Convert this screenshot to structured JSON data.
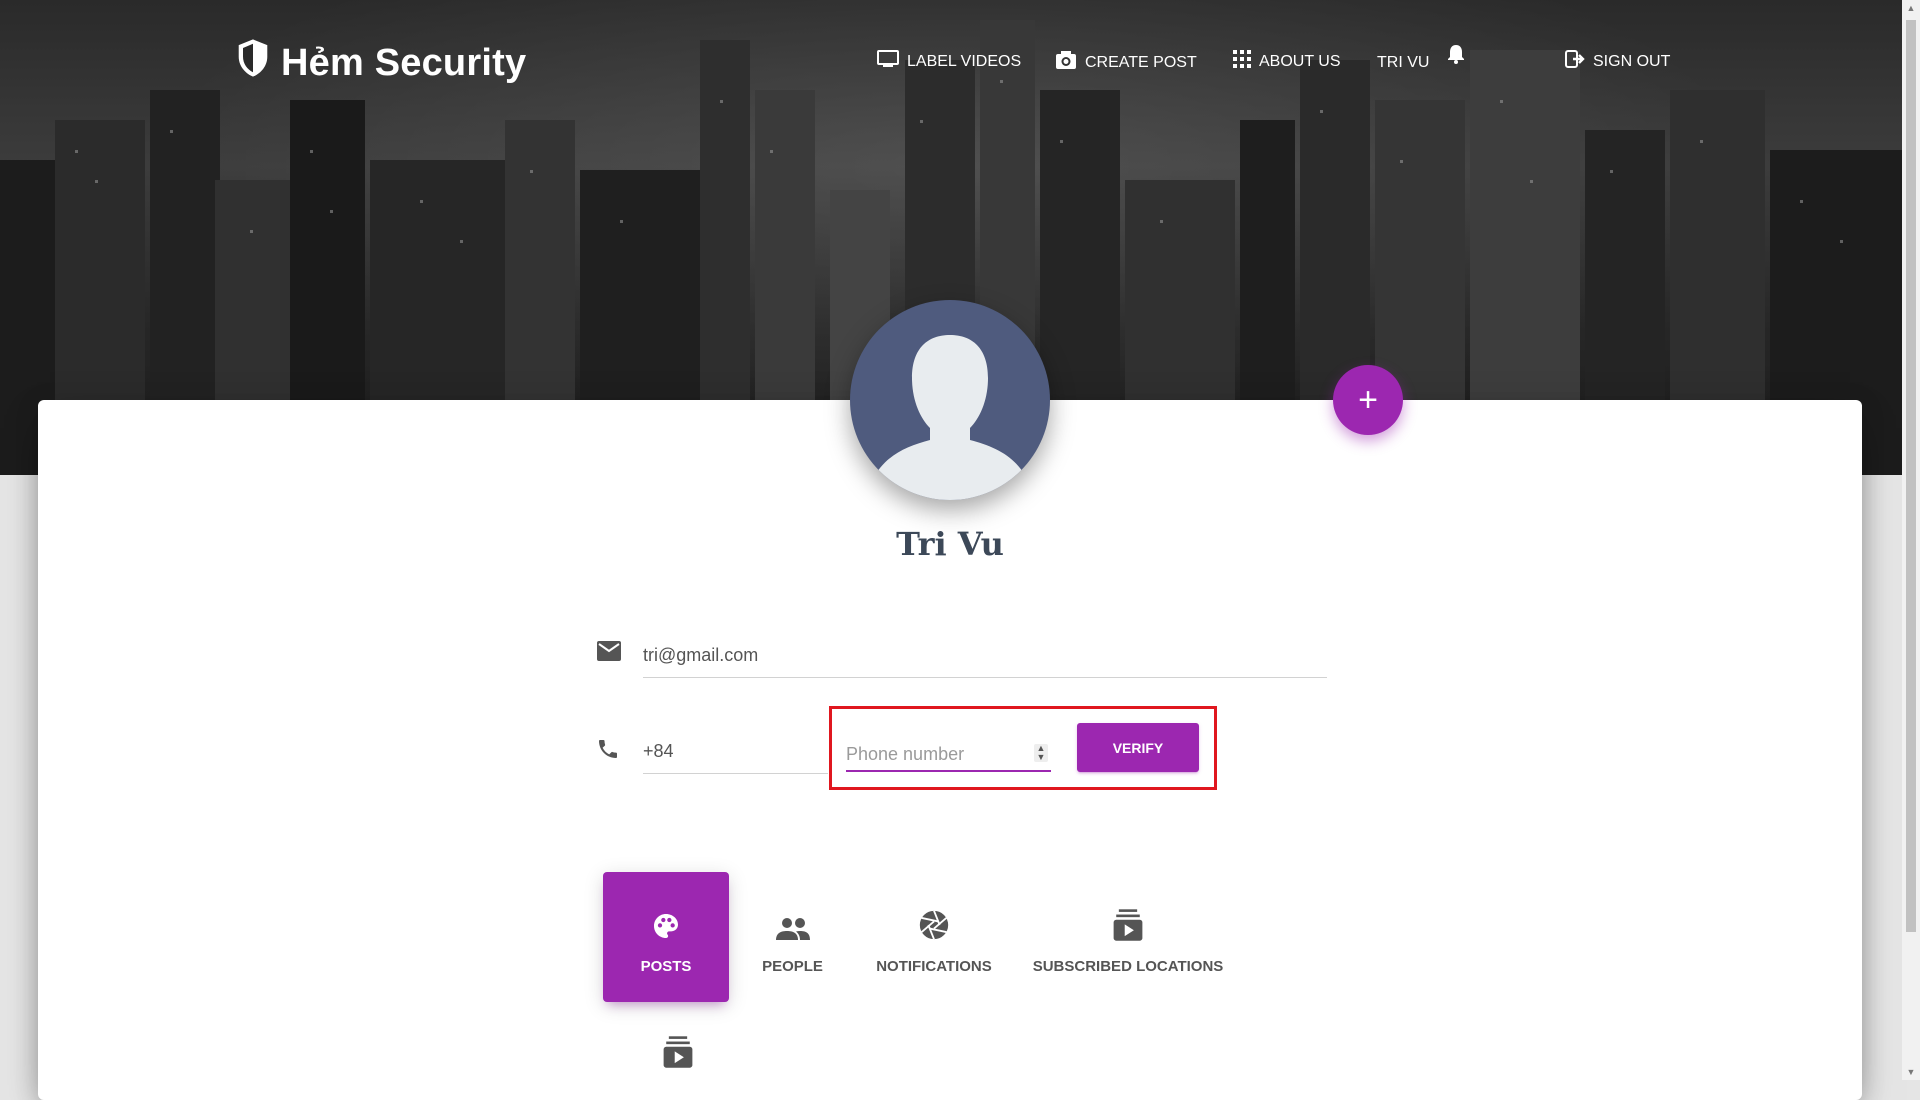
{
  "brand": {
    "name": "Hẻm Security",
    "icon": "shield-icon"
  },
  "nav": {
    "items": [
      {
        "label": "LABEL VIDEOS",
        "icon": "monitor-icon"
      },
      {
        "label": "CREATE POST",
        "icon": "camera-icon"
      },
      {
        "label": "ABOUT US",
        "icon": "grid-icon"
      },
      {
        "label": "TRI VU",
        "icon": "bell-icon"
      },
      {
        "label": "SIGN OUT",
        "icon": "sign-out-icon"
      }
    ]
  },
  "profile": {
    "name": "Tri Vu",
    "email": "tri@gmail.com",
    "phone_code": "+84",
    "phone_placeholder": "Phone number",
    "verify_label": "VERIFY",
    "add_icon": "plus-icon"
  },
  "tabs": [
    {
      "label": "POSTS",
      "icon": "palette-icon",
      "active": true
    },
    {
      "label": "PEOPLE",
      "icon": "people-icon",
      "active": false
    },
    {
      "label": "NOTIFICATIONS",
      "icon": "camera-aperture-icon",
      "active": false
    },
    {
      "label": "SUBSCRIBED LOCATIONS",
      "icon": "subscriptions-icon",
      "active": false
    }
  ],
  "colors": {
    "accent": "#9c27b0",
    "highlight": "#e0171f",
    "text": "#3c4858"
  }
}
